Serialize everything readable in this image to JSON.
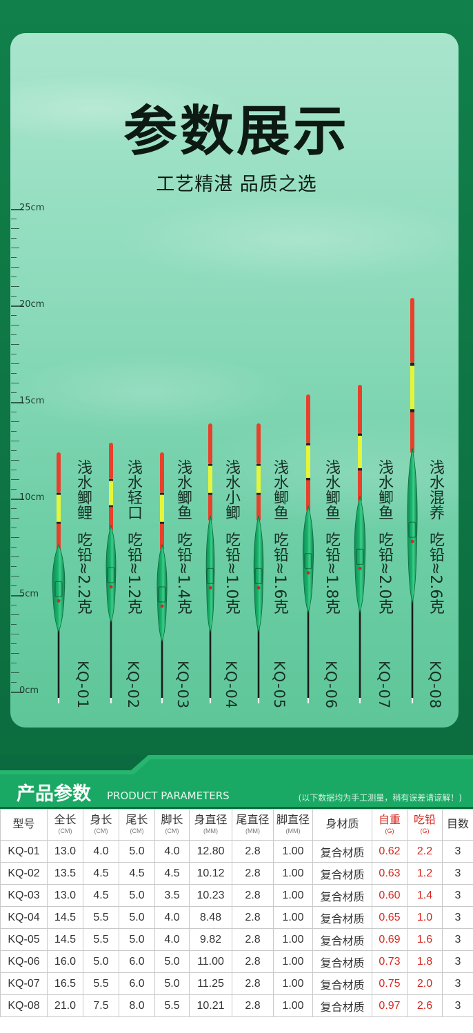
{
  "header": {
    "title": "参数展示",
    "subtitle": "工艺精湛 品质之选"
  },
  "ruler": {
    "labels": [
      "25cm",
      "20cm",
      "15cm",
      "10cm",
      "5cm",
      "0cm"
    ]
  },
  "floats": [
    {
      "model": "KQ-01",
      "name": "浅水鲫鲤",
      "lead": "吃铅≈2.2克",
      "length_cm": 13.0
    },
    {
      "model": "KQ-02",
      "name": "浅水轻口",
      "lead": "吃铅≈1.2克",
      "length_cm": 13.5
    },
    {
      "model": "KQ-03",
      "name": "浅水鲫鱼",
      "lead": "吃铅≈1.4克",
      "length_cm": 13.0
    },
    {
      "model": "KQ-04",
      "name": "浅水小鲫",
      "lead": "吃铅≈1.0克",
      "length_cm": 14.5
    },
    {
      "model": "KQ-05",
      "name": "浅水鲫鱼",
      "lead": "吃铅≈1.6克",
      "length_cm": 14.5
    },
    {
      "model": "KQ-06",
      "name": "浅水鲫鱼",
      "lead": "吃铅≈1.8克",
      "length_cm": 16.0
    },
    {
      "model": "KQ-07",
      "name": "浅水鲫鱼",
      "lead": "吃铅≈2.0克",
      "length_cm": 16.5
    },
    {
      "model": "KQ-08",
      "name": "浅水混养",
      "lead": "吃铅≈2.6克",
      "length_cm": 21.0
    }
  ],
  "colors": {
    "tip_red": "#e8402a",
    "tip_yellow": "#e6f53a",
    "body_green": "#19b56d",
    "panel_green": "#0c6d3f"
  },
  "params": {
    "title": "产品参数",
    "title_en": "PRODUCT PARAMETERS",
    "note": "(以下数据均为手工测量，稍有误差请谅解！)",
    "columns": [
      {
        "label": "型号",
        "unit": ""
      },
      {
        "label": "全长",
        "unit": "(CM)"
      },
      {
        "label": "身长",
        "unit": "(CM)"
      },
      {
        "label": "尾长",
        "unit": "(CM)"
      },
      {
        "label": "脚长",
        "unit": "(CM)"
      },
      {
        "label": "身直径",
        "unit": "(MM)"
      },
      {
        "label": "尾直径",
        "unit": "(MM)"
      },
      {
        "label": "脚直径",
        "unit": "(MM)"
      },
      {
        "label": "身材质",
        "unit": ""
      },
      {
        "label": "自重",
        "unit": "(G)"
      },
      {
        "label": "吃铅",
        "unit": "(G)"
      },
      {
        "label": "目数",
        "unit": ""
      }
    ],
    "rows": [
      [
        "KQ-01",
        "13.0",
        "4.0",
        "5.0",
        "4.0",
        "12.80",
        "2.8",
        "1.00",
        "复合材质",
        "0.62",
        "2.2",
        "3"
      ],
      [
        "KQ-02",
        "13.5",
        "4.5",
        "4.5",
        "4.5",
        "10.12",
        "2.8",
        "1.00",
        "复合材质",
        "0.63",
        "1.2",
        "3"
      ],
      [
        "KQ-03",
        "13.0",
        "4.5",
        "5.0",
        "3.5",
        "10.23",
        "2.8",
        "1.00",
        "复合材质",
        "0.60",
        "1.4",
        "3"
      ],
      [
        "KQ-04",
        "14.5",
        "5.5",
        "5.0",
        "4.0",
        "8.48",
        "2.8",
        "1.00",
        "复合材质",
        "0.65",
        "1.0",
        "3"
      ],
      [
        "KQ-05",
        "14.5",
        "5.5",
        "5.0",
        "4.0",
        "9.82",
        "2.8",
        "1.00",
        "复合材质",
        "0.69",
        "1.6",
        "3"
      ],
      [
        "KQ-06",
        "16.0",
        "5.0",
        "6.0",
        "5.0",
        "11.00",
        "2.8",
        "1.00",
        "复合材质",
        "0.73",
        "1.8",
        "3"
      ],
      [
        "KQ-07",
        "16.5",
        "5.5",
        "6.0",
        "5.0",
        "11.25",
        "2.8",
        "1.00",
        "复合材质",
        "0.75",
        "2.0",
        "3"
      ],
      [
        "KQ-08",
        "21.0",
        "7.5",
        "8.0",
        "5.5",
        "10.21",
        "2.8",
        "1.00",
        "复合材质",
        "0.97",
        "2.6",
        "3"
      ]
    ]
  }
}
